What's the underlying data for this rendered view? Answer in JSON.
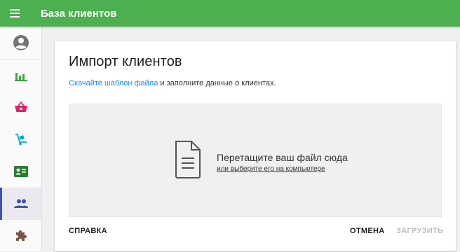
{
  "appbar": {
    "title": "База клиентов",
    "menu_icon": "hamburger-menu-icon",
    "color": "#4caf50"
  },
  "sidebar": {
    "items": [
      {
        "name": "account",
        "icon": "account-circle-icon",
        "color": "#757575",
        "active": false
      },
      {
        "name": "statistics",
        "icon": "bar-chart-icon",
        "color": "#43a047",
        "active": false
      },
      {
        "name": "orders",
        "icon": "shopping-basket-icon",
        "color": "#e91e63",
        "active": false
      },
      {
        "name": "delivery",
        "icon": "hand-truck-icon",
        "color": "#00acc1",
        "active": false
      },
      {
        "name": "contacts",
        "icon": "contact-card-icon",
        "color": "#2e7d32",
        "active": false
      },
      {
        "name": "clients",
        "icon": "people-icon",
        "color": "#3f51b5",
        "active": true
      },
      {
        "name": "extensions",
        "icon": "puzzle-icon",
        "color": "#795548",
        "active": false
      }
    ]
  },
  "card": {
    "title": "Импорт клиентов",
    "template_link": "Скачайте шаблон файла",
    "subtitle_rest": " и заполните данные о клиентах.",
    "dropzone": {
      "main": "Перетащите ваш файл сюда",
      "link": "или выберите его на компьютере",
      "icon": "document-icon"
    },
    "actions": {
      "help": "СПРАВКА",
      "cancel": "ОТМЕНА",
      "upload": "ЗАГРУЗИТЬ"
    }
  }
}
